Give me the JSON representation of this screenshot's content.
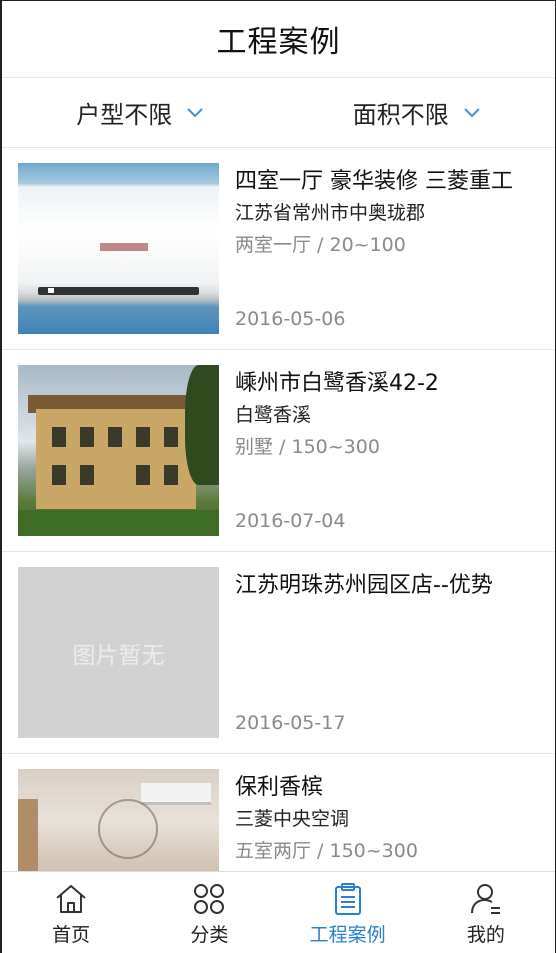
{
  "header": {
    "title": "工程案例"
  },
  "filters": [
    {
      "label": "户型不限"
    },
    {
      "label": "面积不限"
    }
  ],
  "cases": [
    {
      "name": "四室一厅 豪华装修 三菱重工",
      "address": "江苏省常州市中奥珑郡",
      "spec": "两室一厅 / 20~100",
      "date": "2016-05-06",
      "image": "air-conditioner"
    },
    {
      "name": "嵊州市白鹭香溪42-2",
      "address": "白鹭香溪",
      "spec": "别墅 / 150~300",
      "date": "2016-07-04",
      "image": "villa"
    },
    {
      "name": "江苏明珠苏州园区店--优势",
      "address": "",
      "spec": "",
      "date": "2016-05-17",
      "image": "placeholder",
      "placeholder_text": "图片暂无"
    },
    {
      "name": "保利香槟",
      "address": "三菱中央空调",
      "spec": "五室两厅 / 150~300",
      "date": "",
      "image": "interior"
    }
  ],
  "tabbar": {
    "active_color": "#2a7fd4",
    "items": [
      {
        "label": "首页",
        "icon": "home-icon"
      },
      {
        "label": "分类",
        "icon": "category-icon"
      },
      {
        "label": "工程案例",
        "icon": "clipboard-icon",
        "active": true
      },
      {
        "label": "我的",
        "icon": "user-icon"
      }
    ]
  }
}
